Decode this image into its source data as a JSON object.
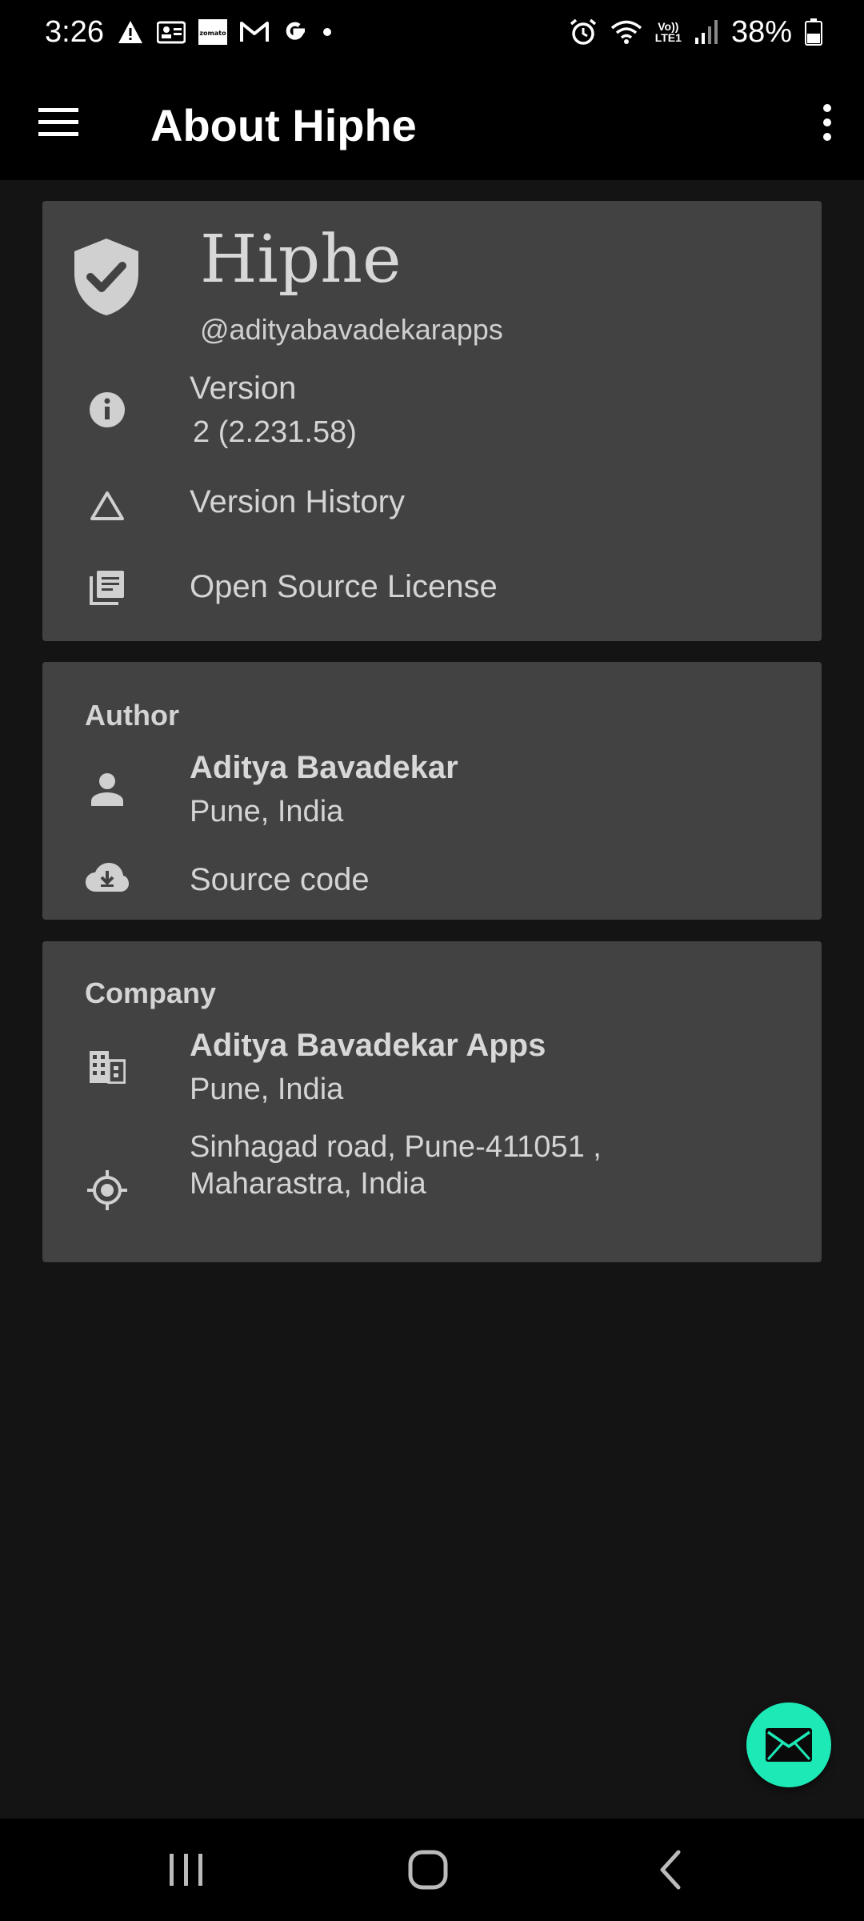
{
  "status_bar": {
    "time": "3:26",
    "battery": "38%",
    "left_icons": [
      "warning-icon",
      "contact-card-icon",
      "zomato-icon",
      "gmail-icon",
      "google-icon",
      "dot-icon"
    ],
    "right_icons": [
      "alarm-icon",
      "wifi-icon",
      "volte-icon",
      "signal-icon",
      "battery-icon"
    ],
    "volte_top": "Vo))",
    "volte_bottom": "LTE1",
    "zomato_label": "zomato"
  },
  "app_bar": {
    "title": "About Hiphe",
    "menu_icon": "menu-icon",
    "overflow_icon": "more-vert-icon"
  },
  "about_card": {
    "app_name": "Hiphe",
    "handle": "@adityabavadekarapps",
    "logo_icon": "verified-shield-icon",
    "version_label": "Version",
    "version_value": "2 (2.231.58)",
    "version_history": "Version History",
    "open_source_license": "Open Source License"
  },
  "author_card": {
    "title": "Author",
    "name": "Aditya Bavadekar",
    "location": "Pune, India",
    "source_code": "Source code"
  },
  "company_card": {
    "title": "Company",
    "name": "Aditya Bavadekar Apps",
    "location": "Pune, India",
    "address_line1": "Sinhagad road, Pune-411051 ,",
    "address_line2": "Maharastra, India"
  },
  "fab": {
    "icon": "email-icon"
  },
  "nav_bar": {
    "icons": [
      "recents-icon",
      "home-icon",
      "back-icon"
    ]
  },
  "colors": {
    "background": "#141414",
    "card": "#424242",
    "bar": "#000000",
    "fab": "#1de9b6",
    "text": "#d4d4d4"
  }
}
